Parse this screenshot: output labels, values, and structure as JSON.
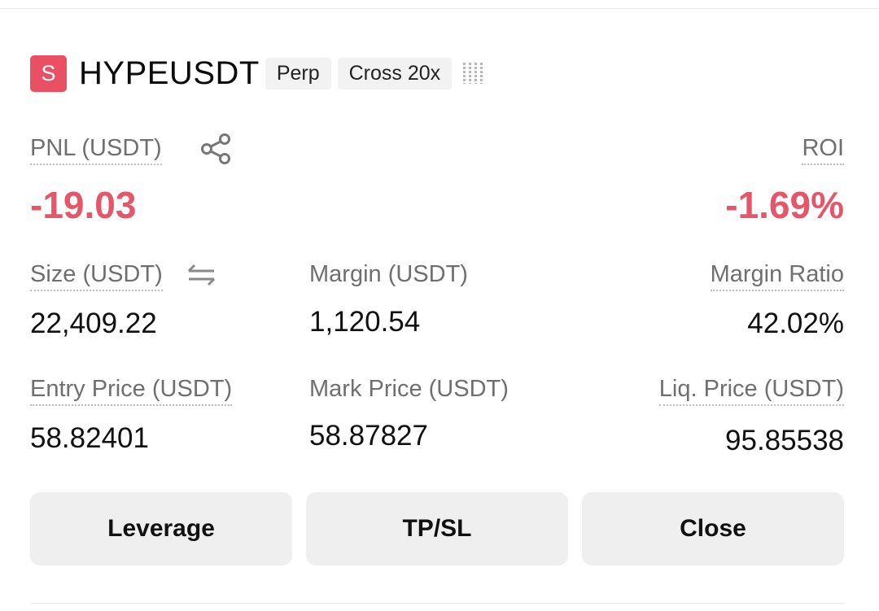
{
  "header": {
    "side_badge": "S",
    "symbol": "HYPEUSDT",
    "tags": [
      "Perp",
      "Cross 20x"
    ],
    "bars_icon": "signal-bars-icon"
  },
  "pnl": {
    "label": "PNL (USDT)",
    "value": "-19.03",
    "share_icon": "share-icon"
  },
  "roi": {
    "label": "ROI",
    "value": "-1.69%"
  },
  "stats": {
    "size": {
      "label": "Size (USDT)",
      "value": "22,409.22",
      "switch_icon": "swap-arrows-icon"
    },
    "margin": {
      "label": "Margin (USDT)",
      "value": "1,120.54"
    },
    "margin_ratio": {
      "label": "Margin Ratio",
      "value": "42.02%"
    },
    "entry_price": {
      "label": "Entry Price (USDT)",
      "value": "58.82401"
    },
    "mark_price": {
      "label": "Mark Price (USDT)",
      "value": "58.87827"
    },
    "liq_price": {
      "label": "Liq. Price (USDT)",
      "value": "95.85538"
    }
  },
  "actions": {
    "leverage": "Leverage",
    "tpsl": "TP/SL",
    "close": "Close"
  },
  "colors": {
    "loss": "#e5566a",
    "badge": "#ea4f63",
    "button_bg": "#efefef"
  }
}
